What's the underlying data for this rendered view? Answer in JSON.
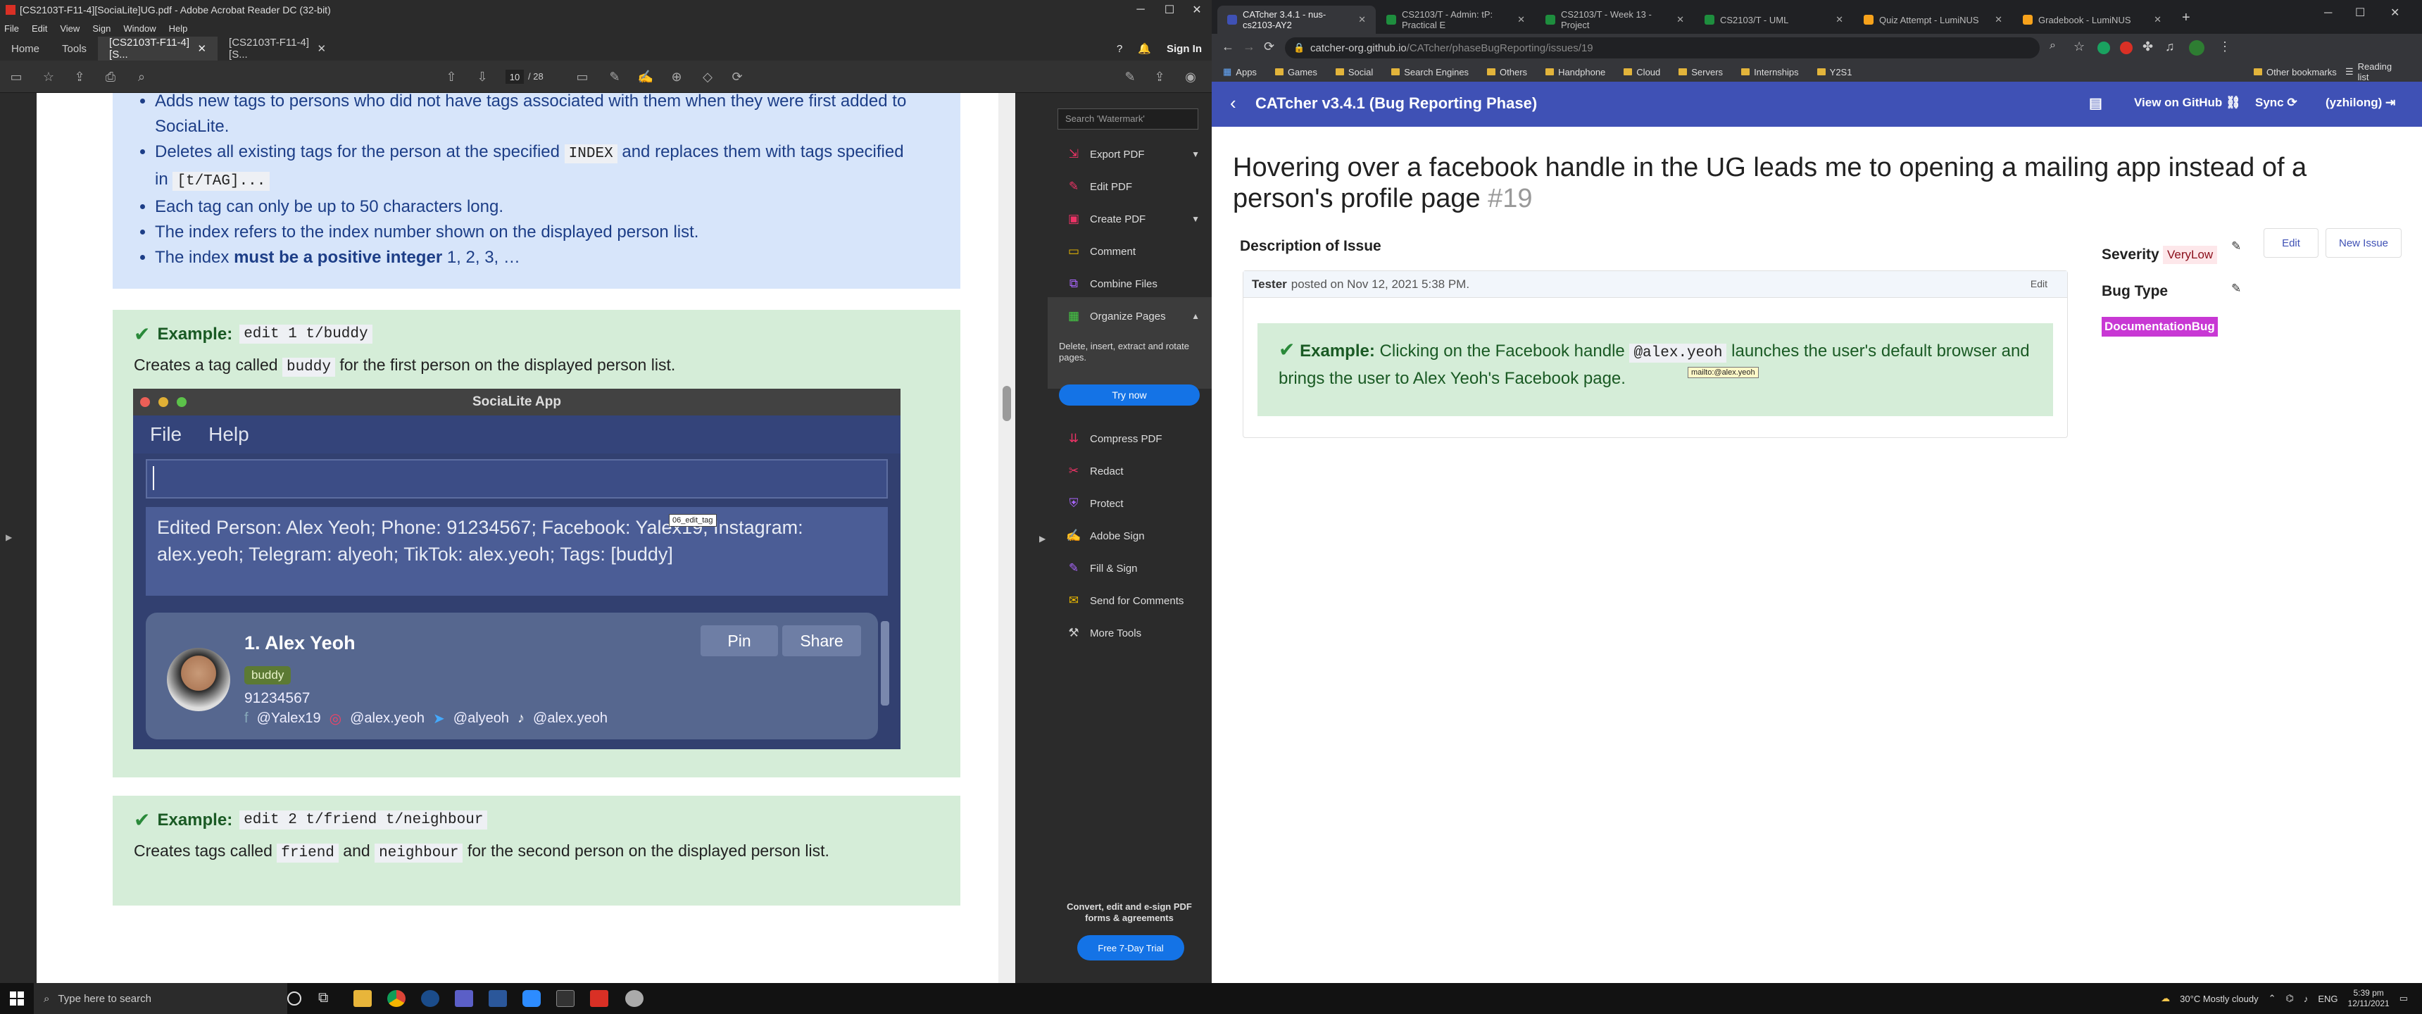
{
  "acrobat": {
    "window_title": "[CS2103T-F11-4][SociaLite]UG.pdf - Adobe Acrobat Reader DC (32-bit)",
    "menu": [
      "File",
      "Edit",
      "View",
      "Sign",
      "Window",
      "Help"
    ],
    "tabs": {
      "home": "Home",
      "tools": "Tools",
      "doc1": "[CS2103T-F11-4][S...",
      "doc2": "[CS2103T-F11-4][S..."
    },
    "sign_in": "Sign In",
    "page_current": "10",
    "page_total": "/ 28",
    "page": {
      "bullets": [
        "Adds new tags to persons who did not have tags associated with them when they were first added to SociaLite.",
        "Each tag can only be up to 50 characters long.",
        "The index refers to the index number shown on the displayed person list."
      ],
      "bullet2_a": "Deletes all existing tags for the person at the specified",
      "bullet2_code": "INDEX",
      "bullet2_b": "and replaces them with tags specified in",
      "bullet2_code2": "[t/TAG]...",
      "bullet5_a": "The index",
      "bullet5_bold": "must be a positive integer",
      "bullet5_b": "1, 2, 3, …",
      "example_label": "Example:",
      "ex1_code": "edit 1 t/buddy",
      "ex1_text_a": "Creates a tag called",
      "ex1_text_code": "buddy",
      "ex1_text_b": "for the first person on the displayed person list.",
      "ex2_code": "edit 2 t/friend t/neighbour",
      "ex2_text_a": "Creates tags called",
      "ex2_text_code1": "friend",
      "ex2_text_and": "and",
      "ex2_text_code2": "neighbour",
      "ex2_text_b": "for the second person on the displayed person list.",
      "img_tooltip": "06_edit_tag"
    },
    "socialite": {
      "title": "SociaLite App",
      "menu": [
        "File",
        "Help"
      ],
      "result": "Edited Person: Alex Yeoh; Phone: 91234567; Facebook: Yalex19; Instagram: alex.yeoh; Telegram: alyeoh; TikTok: alex.yeoh; Tags: [buddy]",
      "card": {
        "name": "1.  Alex Yeoh",
        "tag": "buddy",
        "phone": "91234567",
        "facebook": "@Yalex19",
        "instagram": "@alex.yeoh",
        "telegram": "@alyeoh",
        "tiktok": "@alex.yeoh",
        "pin": "Pin",
        "share": "Share"
      }
    },
    "right_pane": {
      "search_placeholder": "Search 'Watermark'",
      "tools": [
        "Export PDF",
        "Edit PDF",
        "Create PDF",
        "Comment",
        "Combine Files",
        "Organize Pages"
      ],
      "organize_desc": "Delete, insert, extract and rotate pages.",
      "try_now": "Try now",
      "tools2": [
        "Compress PDF",
        "Redact",
        "Protect",
        "Adobe Sign",
        "Fill & Sign",
        "Send for Comments",
        "More Tools"
      ],
      "convert": "Convert, edit and e-sign PDF forms & agreements",
      "free_trial": "Free 7-Day Trial"
    }
  },
  "chrome": {
    "tabs": [
      "CATcher 3.4.1 - nus-cs2103-AY2",
      "CS2103/T - Admin: tP: Practical E",
      "CS2103/T - Week 13 - Project",
      "CS2103/T - UML",
      "Quiz Attempt - LumiNUS",
      "Gradebook - LumiNUS"
    ],
    "url_host": "catcher-org.github.io",
    "url_path": "/CATcher/phaseBugReporting/issues/19",
    "bookmarks": [
      "Apps",
      "Games",
      "Social",
      "Search Engines",
      "Others",
      "Handphone",
      "Cloud",
      "Servers",
      "Internships",
      "Y2S1"
    ],
    "other_bookmarks": "Other bookmarks",
    "reading_list": "Reading list",
    "catcher": {
      "title": "CATcher v3.4.1  (Bug Reporting Phase)",
      "view_on_github": "View on GitHub",
      "sync": "Sync",
      "user": "(yzhilong)",
      "issue_title": "Hovering over a facebook handle in the UG leads me to opening a mailing app instead of a person's profile page",
      "issue_number": "#19",
      "description_heading": "Description of Issue",
      "comment_author": "Tester",
      "comment_meta": "posted on Nov 12, 2021 5:38 PM.",
      "comment_edit": "Edit",
      "ex_label": "Example:",
      "ex_text_a": "Clicking on the Facebook handle",
      "ex_code": "@alex.yeoh",
      "ex_text_b": "launches the user's default browser and brings the user to Alex Yeoh's Facebook page.",
      "mailto_tip": "mailto:@alex.yeoh",
      "severity_label": "Severity",
      "severity": "VeryLow",
      "bugtype_label": "Bug Type",
      "bugtype": "DocumentationBug",
      "edit_btn": "Edit",
      "new_issue_btn": "New Issue"
    }
  },
  "taskbar": {
    "search_placeholder": "Type here to search",
    "weather": "30°C  Mostly cloudy",
    "lang": "ENG",
    "time": "5:39 pm",
    "date": "12/11/2021"
  }
}
